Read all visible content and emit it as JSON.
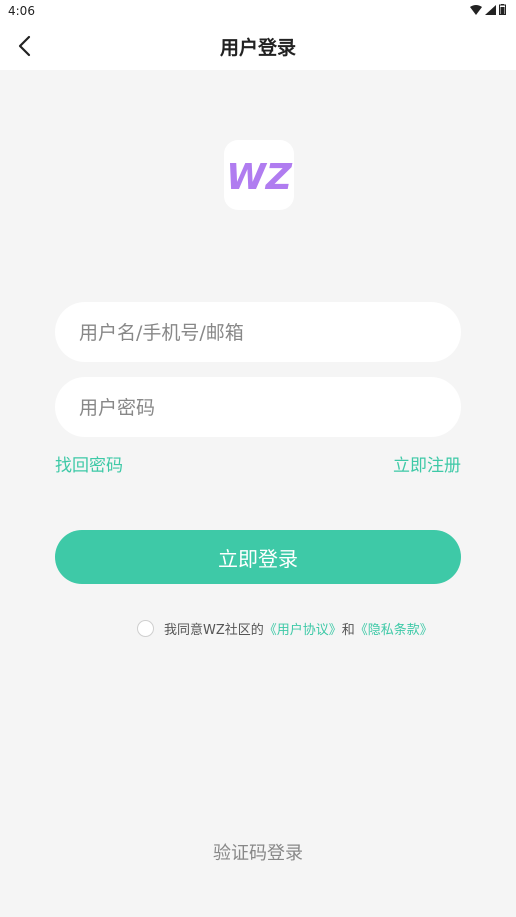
{
  "status_bar": {
    "time": "4:06"
  },
  "header": {
    "title": "用户登录"
  },
  "logo": {
    "text": "WZ"
  },
  "form": {
    "username_placeholder": "用户名/手机号/邮箱",
    "password_placeholder": "用户密码",
    "forgot_password": "找回密码",
    "register": "立即注册",
    "login_button": "立即登录"
  },
  "agreement": {
    "prefix": "我同意WZ社区的",
    "user_agreement": "《用户协议》",
    "and": "和",
    "privacy_policy": "《隐私条款》"
  },
  "footer": {
    "sms_login": "验证码登录"
  },
  "colors": {
    "accent": "#3ec9a7",
    "logo_purple": "#b07cf0"
  }
}
